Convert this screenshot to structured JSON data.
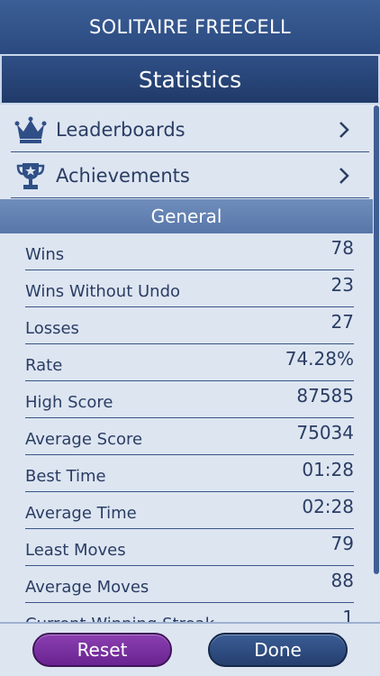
{
  "app": {
    "title": "SOLITAIRE FREECELL"
  },
  "screen": {
    "title": "Statistics"
  },
  "nav": [
    {
      "label": "Leaderboards",
      "icon": "crown-icon"
    },
    {
      "label": "Achievements",
      "icon": "trophy-icon"
    }
  ],
  "general": {
    "title": "General",
    "stats": [
      {
        "label": "Wins",
        "value": "78"
      },
      {
        "label": "Wins Without Undo",
        "value": "23"
      },
      {
        "label": "Losses",
        "value": "27"
      },
      {
        "label": "Rate",
        "value": "74.28%"
      },
      {
        "label": "High Score",
        "value": "87585"
      },
      {
        "label": "Average Score",
        "value": "75034"
      },
      {
        "label": "Best Time",
        "value": "01:28"
      },
      {
        "label": "Average Time",
        "value": "02:28"
      },
      {
        "label": "Least Moves",
        "value": "79"
      },
      {
        "label": "Average Moves",
        "value": "88"
      },
      {
        "label": "Current Winning Streak",
        "value": "1"
      }
    ]
  },
  "footer": {
    "reset_label": "Reset",
    "done_label": "Done"
  },
  "colors": {
    "header": "#2a4a7f",
    "text": "#2a3d63",
    "reset": "#7a2fa0",
    "done": "#2f4f86"
  }
}
